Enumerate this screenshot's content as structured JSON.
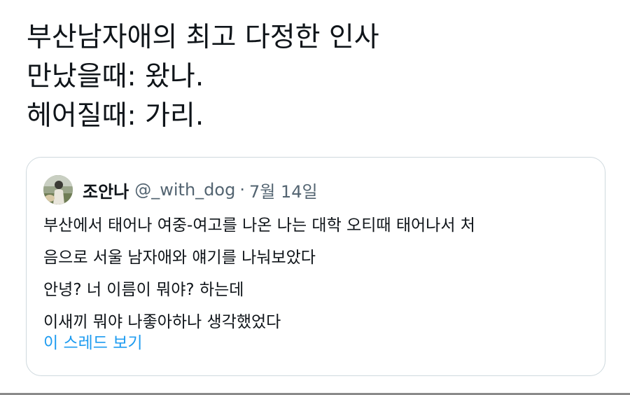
{
  "tweet": {
    "lines": [
      "부산남자애의 최고 다정한 인사",
      "만났을때: 왔나.",
      "헤어질때: 가리."
    ]
  },
  "quoted_tweet": {
    "display_name": "조안나",
    "handle": "@_with_dog",
    "separator": "·",
    "date": "7월 14일",
    "lines": [
      "부산에서 태어나 여중-여고를 나온 나는 대학 오티때 태어나서 처",
      "음으로 서울 남자애와 얘기를 나눠보았다",
      "안녕? 너 이름이 뭐야? 하는데",
      "이새끼 뭐야 나좋아하나 생각했었다"
    ],
    "show_thread_label": "이 스레드 보기",
    "avatar_icon": "profile-photo-icon"
  },
  "colors": {
    "text_primary": "#0f1419",
    "text_secondary": "#536471",
    "link": "#1d9bf0",
    "card_border": "#cfd9de"
  }
}
